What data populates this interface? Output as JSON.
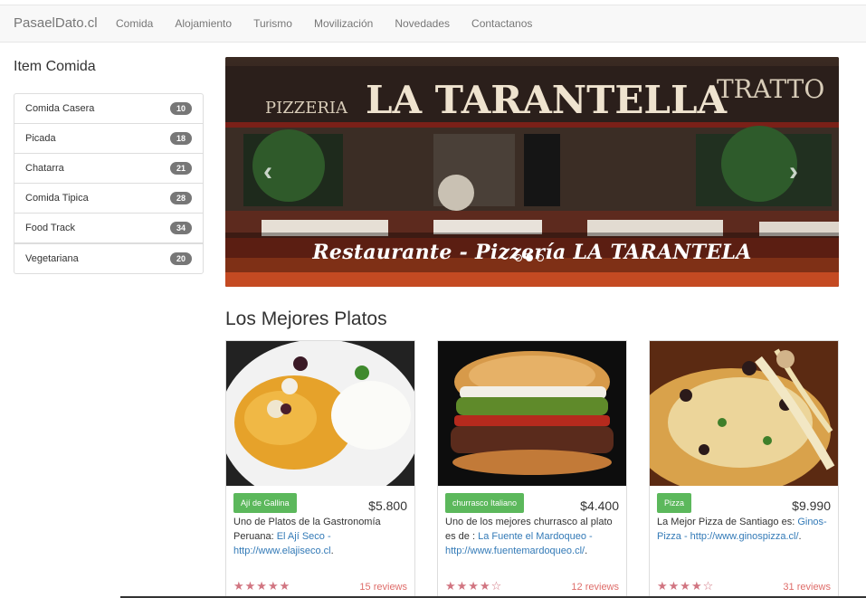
{
  "navbar": {
    "brand": "PasaelDato.cl",
    "links": [
      "Comida",
      "Alojamiento",
      "Turismo",
      "Movilización",
      "Novedades",
      "Contactanos"
    ]
  },
  "sidebar": {
    "title": "Item Comida",
    "items": [
      {
        "label": "Comida Casera",
        "count": "10"
      },
      {
        "label": "Picada",
        "count": "18"
      },
      {
        "label": "Chatarra",
        "count": "21"
      },
      {
        "label": "Comida Tipica",
        "count": "28"
      },
      {
        "label": "Food Track",
        "count": "34"
      },
      {
        "label": "Vegetariana",
        "count": "20"
      }
    ]
  },
  "carousel": {
    "caption": "Restaurante - Pizzería LA TARANTELA",
    "sign_text": "LA TARANTELLA",
    "sign_left": "PIZZERIA",
    "sign_right": "TRATTO",
    "prev_icon": "‹",
    "next_icon": "›"
  },
  "section": {
    "title": "Los Mejores Platos"
  },
  "cards": [
    {
      "tag": "Ají de Gallina",
      "price": "$5.800",
      "desc_prefix": "Uno de Platos de la Gastronomía Peruana: ",
      "link_text": "El Ají Seco - http://www.elajiseco.cl",
      "desc_suffix": ".",
      "stars": "★★★★★",
      "reviews": "15 reviews"
    },
    {
      "tag": "churrasco Italiano",
      "price": "$4.400",
      "desc_prefix": "Uno de los mejores churrasco al plato es de : ",
      "link_text": "La Fuente el Mardoqueo - http://www.fuentemardoqueo.cl/",
      "desc_suffix": ".",
      "stars": "★★★★☆",
      "reviews": "12 reviews"
    },
    {
      "tag": "Pizza",
      "price": "$9.990",
      "desc_prefix": "La Mejor Pizza de Santiago es: ",
      "link_text": "Ginos-Pizza - http://www.ginospizza.cl/",
      "desc_suffix": ".",
      "stars": "★★★★☆",
      "reviews": "31 reviews"
    }
  ],
  "colors": {
    "tag_green": "#5cb85c",
    "link_blue": "#337ab7",
    "badge_gray": "#777777",
    "star_pink": "#d17581"
  }
}
